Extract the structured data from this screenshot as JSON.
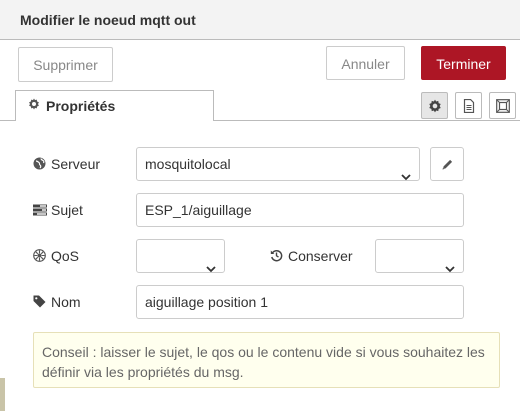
{
  "dialog": {
    "title": "Modifier le noeud mqtt out",
    "delete_label": "Supprimer",
    "cancel_label": "Annuler",
    "done_label": "Terminer",
    "accent_color": "#ad1625"
  },
  "tabs": {
    "properties_label": "Propriétés",
    "buttons": [
      "gear-icon",
      "document-icon",
      "frame-icon"
    ]
  },
  "form": {
    "server": {
      "label": "Serveur",
      "value": "mosquitolocal",
      "icon": "globe-icon"
    },
    "topic": {
      "label": "Sujet",
      "value": "ESP_1/aiguillage",
      "icon": "tasks-icon"
    },
    "qos": {
      "label": "QoS",
      "value": "",
      "icon": "empire-icon"
    },
    "retain": {
      "label": "Conserver",
      "value": "",
      "icon": "history-icon"
    },
    "name": {
      "label": "Nom",
      "value": "aiguillage position 1",
      "icon": "tag-icon"
    }
  },
  "tip": {
    "text": "Conseil : laisser le sujet, le qos ou le contenu vide si vous souhaitez les définir via les propriétés du msg."
  }
}
